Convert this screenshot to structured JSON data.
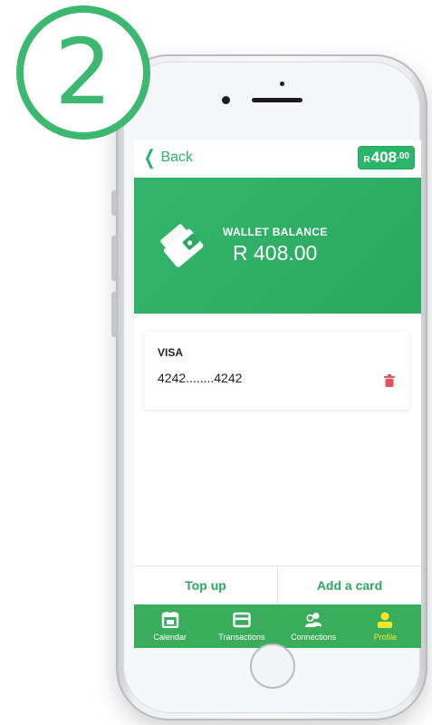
{
  "step": {
    "number": "2"
  },
  "nav": {
    "back_label": "Back",
    "balance_currency": "R",
    "balance_main": "408",
    "balance_cents": ".00"
  },
  "wallet": {
    "label": "WALLET BALANCE",
    "amount": "R 408.00",
    "icon": "wallet-icon"
  },
  "cards": [
    {
      "brand": "VISA",
      "number": "4242........4242",
      "delete_icon": "trash-icon"
    }
  ],
  "actions": {
    "top_up": "Top up",
    "add_card": "Add a card"
  },
  "tabs": [
    {
      "label": "Calendar",
      "icon": "calendar-icon"
    },
    {
      "label": "Transactions",
      "icon": "card-icon"
    },
    {
      "label": "Connections",
      "icon": "connections-icon"
    },
    {
      "label": "Profile",
      "icon": "profile-icon",
      "active": true
    }
  ],
  "colors": {
    "accent": "#2bb56a",
    "step_ring": "#3db870",
    "tabbar": "#3aad5c",
    "active_tab": "#f6e528",
    "delete": "#e8505b"
  }
}
